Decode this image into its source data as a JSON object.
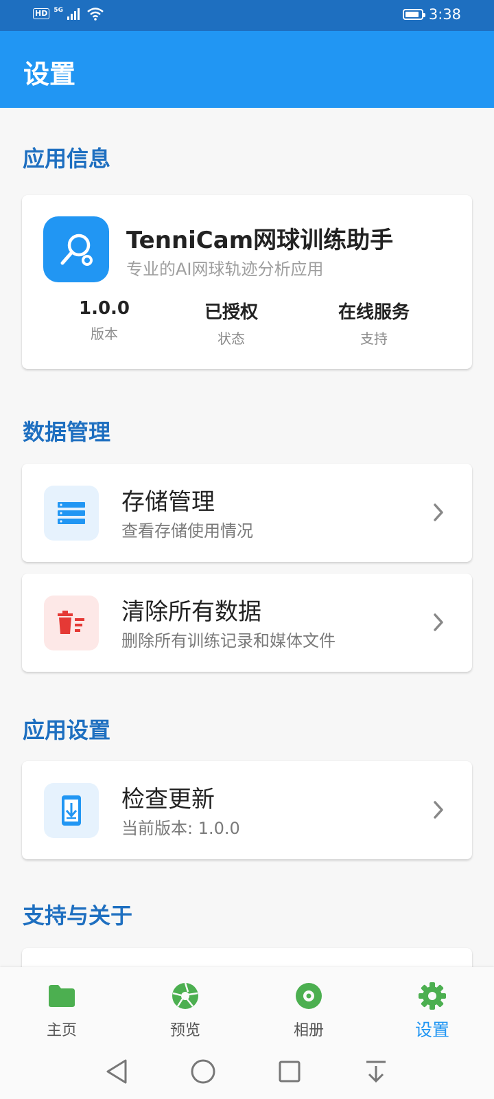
{
  "status_bar": {
    "hd": "HD",
    "network": "5G",
    "time": "3:38",
    "battery_level_percent": 90
  },
  "app_bar": {
    "title": "设置"
  },
  "sections": {
    "app_info": "应用信息",
    "data_management": "数据管理",
    "app_settings": "应用设置",
    "support_about": "支持与关于"
  },
  "app_info": {
    "name": "TenniCam网球训练助手",
    "description": "专业的AI网球轨迹分析应用",
    "stats": [
      {
        "value": "1.0.0",
        "label": "版本"
      },
      {
        "value": "已授权",
        "label": "状态"
      },
      {
        "value": "在线服务",
        "label": "支持"
      }
    ]
  },
  "rows": {
    "storage": {
      "title": "存储管理",
      "subtitle": "查看存储使用情况",
      "icon": "storage-list-icon"
    },
    "clear": {
      "title": "清除所有数据",
      "subtitle": "删除所有训练记录和媒体文件",
      "icon": "delete-sweep-icon"
    },
    "update": {
      "title": "检查更新",
      "subtitle": "当前版本: 1.0.0",
      "icon": "system-update-icon"
    }
  },
  "bottom_nav": [
    {
      "label": "主页",
      "icon": "folder-icon"
    },
    {
      "label": "预览",
      "icon": "camera-shutter-icon"
    },
    {
      "label": "相册",
      "icon": "album-disc-icon"
    },
    {
      "label": "设置",
      "icon": "gear-icon",
      "active": true
    }
  ],
  "colors": {
    "primary": "#2196f3",
    "status_bar": "#1e6fc0",
    "section_title": "#1e6fc0",
    "nav_green": "#4caf50",
    "danger": "#e53935"
  }
}
